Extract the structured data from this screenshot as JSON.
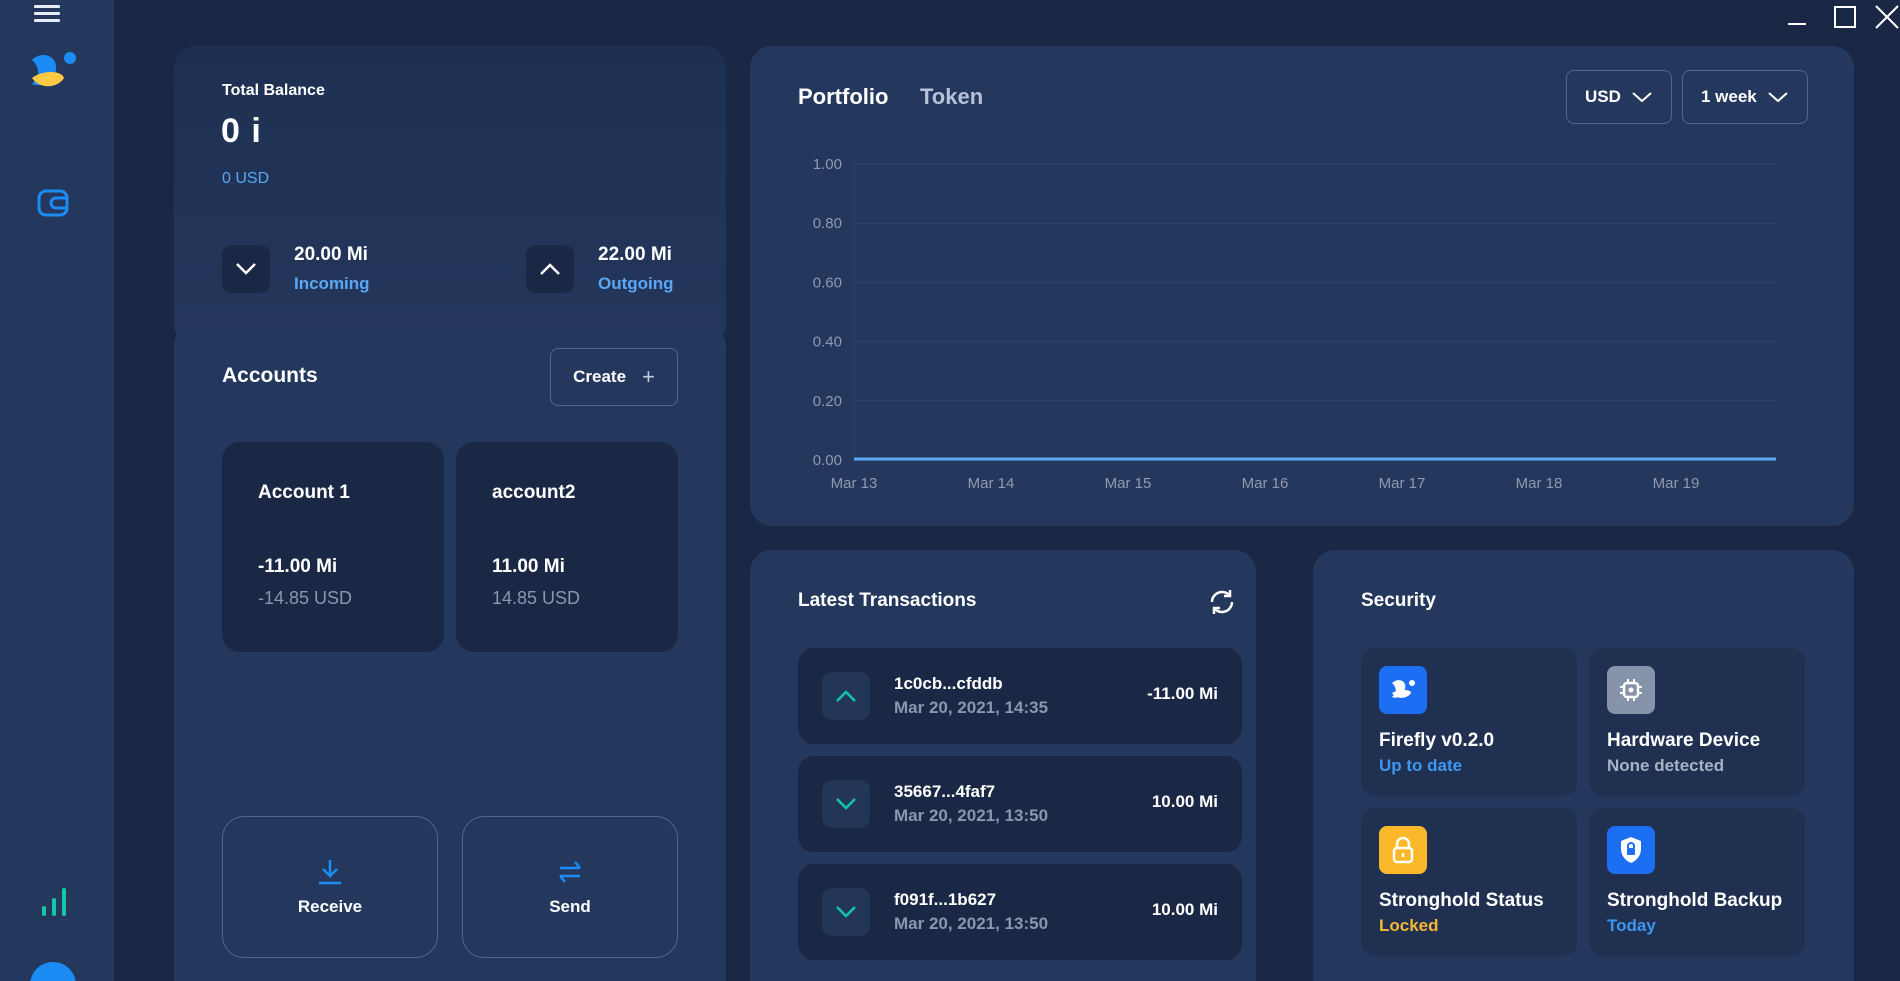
{
  "window": {
    "minimize": "minimize",
    "maximize": "maximize",
    "close": "close"
  },
  "sidebar": {
    "icons": [
      "menu-icon",
      "firefly-logo",
      "wallet-icon",
      "chart-icon",
      "avatar"
    ]
  },
  "balance": {
    "label": "Total Balance",
    "amount": "0 i",
    "fiat": "0 USD",
    "incoming": {
      "amount": "20.00 Mi",
      "label": "Incoming"
    },
    "outgoing": {
      "amount": "22.00 Mi",
      "label": "Outgoing"
    }
  },
  "accounts": {
    "title": "Accounts",
    "create_label": "Create",
    "items": [
      {
        "name": "Account 1",
        "balance": "-11.00 Mi",
        "fiat": "-14.85 USD"
      },
      {
        "name": "account2",
        "balance": "11.00 Mi",
        "fiat": "14.85 USD"
      }
    ],
    "receive_label": "Receive",
    "send_label": "Send"
  },
  "portfolio": {
    "tabs": [
      "Portfolio",
      "Token"
    ],
    "currency": "USD",
    "range": "1 week",
    "colors": {
      "line": "#5aa8f4",
      "grid": "#2e4470"
    }
  },
  "chart_data": {
    "type": "line",
    "x": [
      "Mar 13",
      "Mar 14",
      "Mar 15",
      "Mar 16",
      "Mar 17",
      "Mar 18",
      "Mar 19"
    ],
    "y_ticks": [
      "1.00",
      "0.80",
      "0.60",
      "0.40",
      "0.20",
      "0.00"
    ],
    "ylim": [
      0,
      1
    ],
    "series": [
      {
        "values": [
          0,
          0,
          0,
          0,
          0,
          0,
          0,
          0
        ]
      }
    ],
    "grid": true
  },
  "transactions": {
    "title": "Latest Transactions",
    "items": [
      {
        "hash": "1c0cb...cfddb",
        "date": "Mar 20, 2021, 14:35",
        "amount": "-11.00 Mi",
        "direction": "out"
      },
      {
        "hash": "35667...4faf7",
        "date": "Mar 20, 2021, 13:50",
        "amount": "10.00 Mi",
        "direction": "in"
      },
      {
        "hash": "f091f...1b627",
        "date": "Mar 20, 2021, 13:50",
        "amount": "10.00 Mi",
        "direction": "in"
      }
    ]
  },
  "security": {
    "title": "Security",
    "tiles": [
      {
        "name": "Firefly v0.2.0",
        "status": "Up to date",
        "status_color": "#3d97f0",
        "icon_bg": "#1c6ef2",
        "icon": "firefly-icon"
      },
      {
        "name": "Hardware Device",
        "status": "None detected",
        "status_color": "#a8b2c6",
        "icon_bg": "#8793ab",
        "icon": "chip-icon"
      },
      {
        "name": "Stronghold Status",
        "status": "Locked",
        "status_color": "#f7b731",
        "icon_bg": "#fbb82a",
        "icon": "lock-icon"
      },
      {
        "name": "Stronghold Backup",
        "status": "Today",
        "status_color": "#3d97f0",
        "icon_bg": "#1c6ef2",
        "icon": "shield-icon"
      }
    ]
  }
}
